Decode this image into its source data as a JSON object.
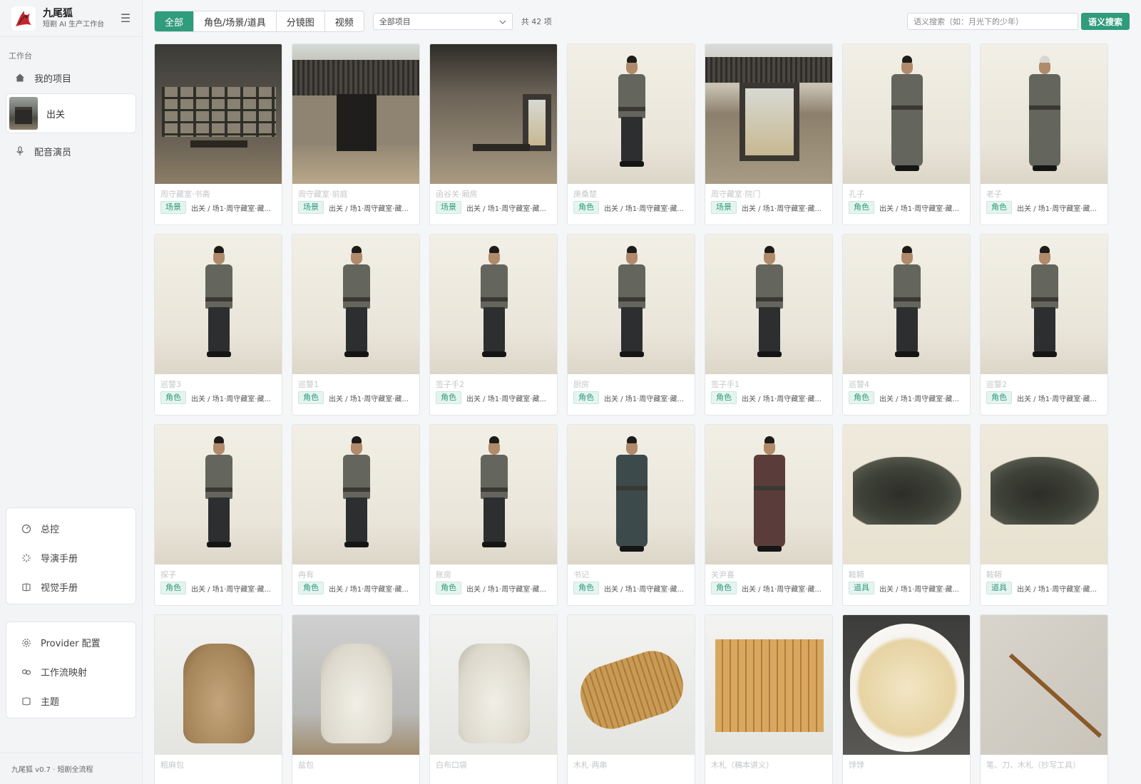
{
  "brand": {
    "name": "九尾狐",
    "subtitle": "短剧 AI 生产工作台"
  },
  "sidebar": {
    "section_label": "工作台",
    "items": [
      {
        "label": "我的项目",
        "icon": "home-icon"
      },
      {
        "label": "配音演员",
        "icon": "microphone-icon"
      }
    ],
    "project": {
      "name": "出关"
    },
    "panel_a": [
      {
        "label": "总控",
        "icon": "dashboard-icon"
      },
      {
        "label": "导演手册",
        "icon": "sparkle-icon"
      },
      {
        "label": "视觉手册",
        "icon": "book-icon"
      }
    ],
    "panel_b": [
      {
        "label": "Provider 配置",
        "icon": "gear-icon"
      },
      {
        "label": "工作流映射",
        "icon": "link-icon"
      },
      {
        "label": "主题",
        "icon": "palette-icon"
      }
    ],
    "footer": "九尾狐 v0.7 · 短剧全流程"
  },
  "toolbar": {
    "tabs": [
      "全部",
      "角色/场景/道具",
      "分镜图",
      "视频"
    ],
    "active_tab": 0,
    "project_select": "全部项目",
    "count": "共 42 项",
    "search_placeholder": "语义搜索（如：月光下的少年）",
    "search_button": "语义搜索"
  },
  "colors": {
    "accent": "#2f9c7c"
  },
  "assets": [
    {
      "title": "周守藏室·书斋",
      "tag": "场景",
      "path": "出关 / 场1·周守藏室·藏...",
      "thumb": "scene-study"
    },
    {
      "title": "周守藏室·前庭",
      "tag": "场景",
      "path": "出关 / 场1·周守藏室·藏...",
      "thumb": "scene-yard"
    },
    {
      "title": "函谷关·厢房",
      "tag": "场景",
      "path": "出关 / 场1·周守藏室·藏...",
      "thumb": "scene-room"
    },
    {
      "title": "庚桑楚",
      "tag": "角色",
      "path": "出关 / 场1·周守藏室·藏...",
      "thumb": "person"
    },
    {
      "title": "周守藏室·院门",
      "tag": "场景",
      "path": "出关 / 场1·周守藏室·藏...",
      "thumb": "scene-gate"
    },
    {
      "title": "孔子",
      "tag": "角色",
      "path": "出关 / 场1·周守藏室·藏...",
      "thumb": "person-robe"
    },
    {
      "title": "老子",
      "tag": "角色",
      "path": "出关 / 场1·周守藏室·藏...",
      "thumb": "person-robe-old"
    },
    {
      "title": "巡警3",
      "tag": "角色",
      "path": "出关 / 场1·周守藏室·藏...",
      "thumb": "person"
    },
    {
      "title": "巡警1",
      "tag": "角色",
      "path": "出关 / 场1·周守藏室·藏...",
      "thumb": "person"
    },
    {
      "title": "签子手2",
      "tag": "角色",
      "path": "出关 / 场1·周守藏室·藏...",
      "thumb": "person"
    },
    {
      "title": "厨房",
      "tag": "角色",
      "path": "出关 / 场1·周守藏室·藏...",
      "thumb": "person"
    },
    {
      "title": "签子手1",
      "tag": "角色",
      "path": "出关 / 场1·周守藏室·藏...",
      "thumb": "person"
    },
    {
      "title": "巡警4",
      "tag": "角色",
      "path": "出关 / 场1·周守藏室·藏...",
      "thumb": "person"
    },
    {
      "title": "巡警2",
      "tag": "角色",
      "path": "出关 / 场1·周守藏室·藏...",
      "thumb": "person"
    },
    {
      "title": "探子",
      "tag": "角色",
      "path": "出关 / 场1·周守藏室·藏...",
      "thumb": "person"
    },
    {
      "title": "冉有",
      "tag": "角色",
      "path": "出关 / 场1·周守藏室·藏...",
      "thumb": "person"
    },
    {
      "title": "账房",
      "tag": "角色",
      "path": "出关 / 场1·周守藏室·藏...",
      "thumb": "person"
    },
    {
      "title": "书记",
      "tag": "角色",
      "path": "出关 / 场1·周守藏室·藏...",
      "thumb": "person-robe-dark"
    },
    {
      "title": "关尹喜",
      "tag": "角色",
      "path": "出关 / 场1·周守藏室·藏...",
      "thumb": "person-robe-red"
    },
    {
      "title": "鞍鞯",
      "tag": "道具",
      "path": "出关 / 场1·周守藏室·藏...",
      "thumb": "saddle"
    },
    {
      "title": "鞍鞯",
      "tag": "道具",
      "path": "出关 / 场1·周守藏室·藏...",
      "thumb": "saddle"
    },
    {
      "title": "粗麻包",
      "tag": "",
      "path": "",
      "thumb": "bag-brown"
    },
    {
      "title": "盐包",
      "tag": "",
      "path": "",
      "thumb": "bag-white"
    },
    {
      "title": "白布口袋",
      "tag": "",
      "path": "",
      "thumb": "bag-white-open"
    },
    {
      "title": "木札·两串",
      "tag": "",
      "path": "",
      "thumb": "scroll"
    },
    {
      "title": "木札（稿本讲义）",
      "tag": "",
      "path": "",
      "thumb": "slips"
    },
    {
      "title": "饽饽",
      "tag": "",
      "path": "",
      "thumb": "buns"
    },
    {
      "title": "笔、刀、木札（抄写工具）",
      "tag": "",
      "path": "",
      "thumb": "brush"
    }
  ]
}
